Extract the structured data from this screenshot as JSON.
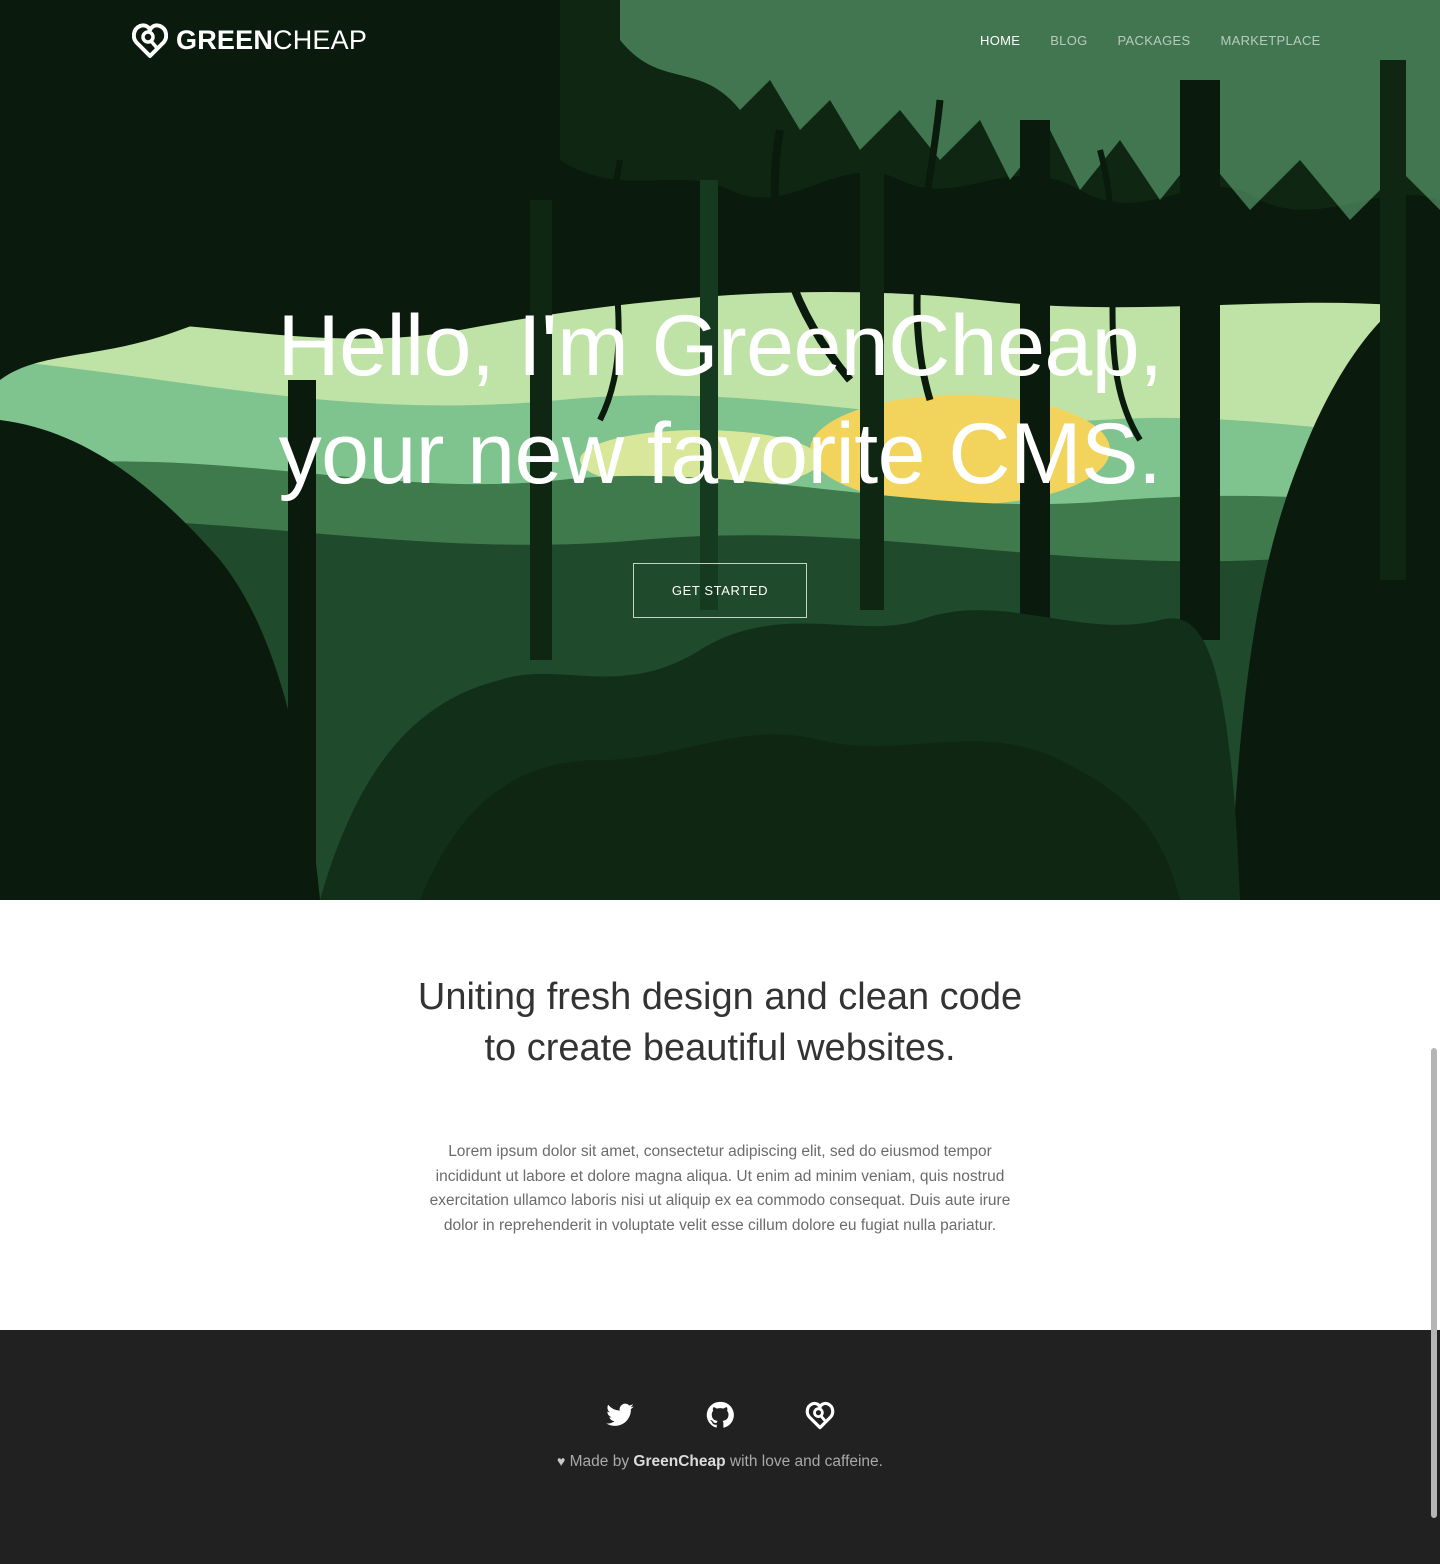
{
  "brand": {
    "bold": "GREEN",
    "light": "CHEAP",
    "logo_icon": "greencheap-heart-logo-icon"
  },
  "nav": {
    "items": [
      {
        "label": "HOME",
        "active": true
      },
      {
        "label": "BLOG",
        "active": false
      },
      {
        "label": "PACKAGES",
        "active": false
      },
      {
        "label": "MARKETPLACE",
        "active": false
      }
    ]
  },
  "hero": {
    "line1": "Hello, I'm GreenCheap,",
    "line2": "your new favorite CMS.",
    "cta_label": "GET STARTED"
  },
  "intro": {
    "heading_line1": "Uniting fresh design and clean code",
    "heading_line2": "to create beautiful websites.",
    "body": "Lorem ipsum dolor sit amet, consectetur adipiscing elit, sed do eiusmod tempor incididunt ut labore et dolore magna aliqua. Ut enim ad minim veniam, quis nostrud exercitation ullamco laboris nisi ut aliquip ex ea commodo consequat. Duis aute irure dolor in reprehenderit in voluptate velit esse cillum dolore eu fugiat nulla pariatur."
  },
  "footer": {
    "social": [
      {
        "icon": "twitter-icon"
      },
      {
        "icon": "github-icon"
      },
      {
        "icon": "greencheap-logo-icon"
      }
    ],
    "credit_prefix": "Made by",
    "credit_brand": "GreenCheap",
    "credit_suffix": "with love and caffeine."
  },
  "colors": {
    "hero_dark": "#0a1a0c",
    "forest_mid": "#1f4a2c",
    "forest_light": "#7fc38f",
    "sun": "#f2d45c",
    "footer_bg": "#212121",
    "heading_text": "#333333"
  }
}
